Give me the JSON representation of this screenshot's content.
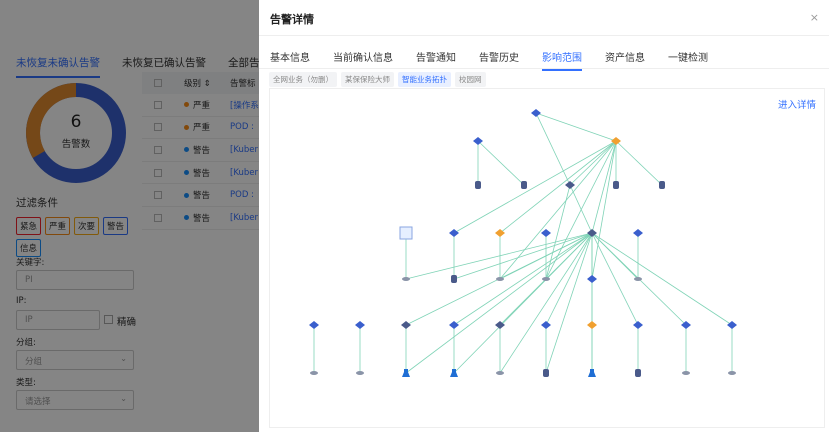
{
  "background": {
    "tabs": [
      "未恢复未确认告警",
      "未恢复已确认告警",
      "全部告警"
    ],
    "donut": {
      "count": "6",
      "label": "告警数",
      "colors": {
        "primary": "#3a5fcd",
        "secondary": "#e08a2e"
      },
      "fraction_secondary": 0.33
    },
    "filter": {
      "title": "过滤条件",
      "chips": [
        "紧急",
        "严重",
        "次要",
        "警告",
        "信息"
      ],
      "keyword_label": "关键字:",
      "keyword_value": "PI",
      "ip_label": "IP:",
      "ip_placeholder": "IP",
      "exact_label": "精确",
      "group_label": "分组:",
      "group_placeholder": "分组",
      "type_label": "类型:",
      "type_placeholder": "请选择"
    },
    "table": {
      "headers": [
        "级别 ⇕",
        "告警标"
      ],
      "rows": [
        {
          "level": "严重",
          "color": "#fa8c16",
          "text": "[操作系"
        },
        {
          "level": "严重",
          "color": "#fa8c16",
          "text": "POD :"
        },
        {
          "level": "警告",
          "color": "#1890ff",
          "text": "[Kuber"
        },
        {
          "level": "警告",
          "color": "#1890ff",
          "text": "[Kuber"
        },
        {
          "level": "警告",
          "color": "#1890ff",
          "text": "POD :"
        },
        {
          "level": "警告",
          "color": "#1890ff",
          "text": "[Kuber"
        }
      ]
    }
  },
  "drawer": {
    "title": "告警详情",
    "close": "×",
    "tabs": [
      {
        "label": "基本信息",
        "active": false
      },
      {
        "label": "当前确认信息",
        "active": false
      },
      {
        "label": "告警通知",
        "active": false
      },
      {
        "label": "告警历史",
        "active": false
      },
      {
        "label": "影响范围",
        "active": true
      },
      {
        "label": "资产信息",
        "active": false
      },
      {
        "label": "一键检测",
        "active": false
      }
    ],
    "sub_tabs": [
      {
        "label": "全网业务（勿删）",
        "active": false
      },
      {
        "label": "某保保险大师",
        "active": false
      },
      {
        "label": "智能业务拓扑",
        "active": true
      },
      {
        "label": "校园网",
        "active": false
      }
    ],
    "enter_detail": "进入详情",
    "topology": {
      "colors": {
        "edge": "#7fd3b6",
        "node_blue": "#3a5fcd",
        "node_orange": "#f0a030",
        "node_dark": "#4a5a8a"
      }
    }
  }
}
